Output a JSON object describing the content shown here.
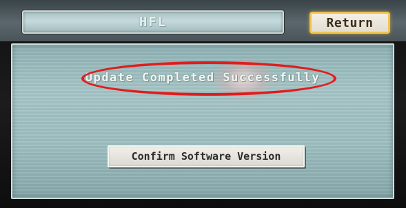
{
  "header": {
    "title": "HFL",
    "return_label": "Return"
  },
  "main": {
    "status_message": "Update Completed Successfully",
    "confirm_button_label": "Confirm Software Version"
  },
  "colors": {
    "panel": "#a7c6c8",
    "return_border": "#f0c34a",
    "highlight_ellipse": "#e01d1d"
  }
}
